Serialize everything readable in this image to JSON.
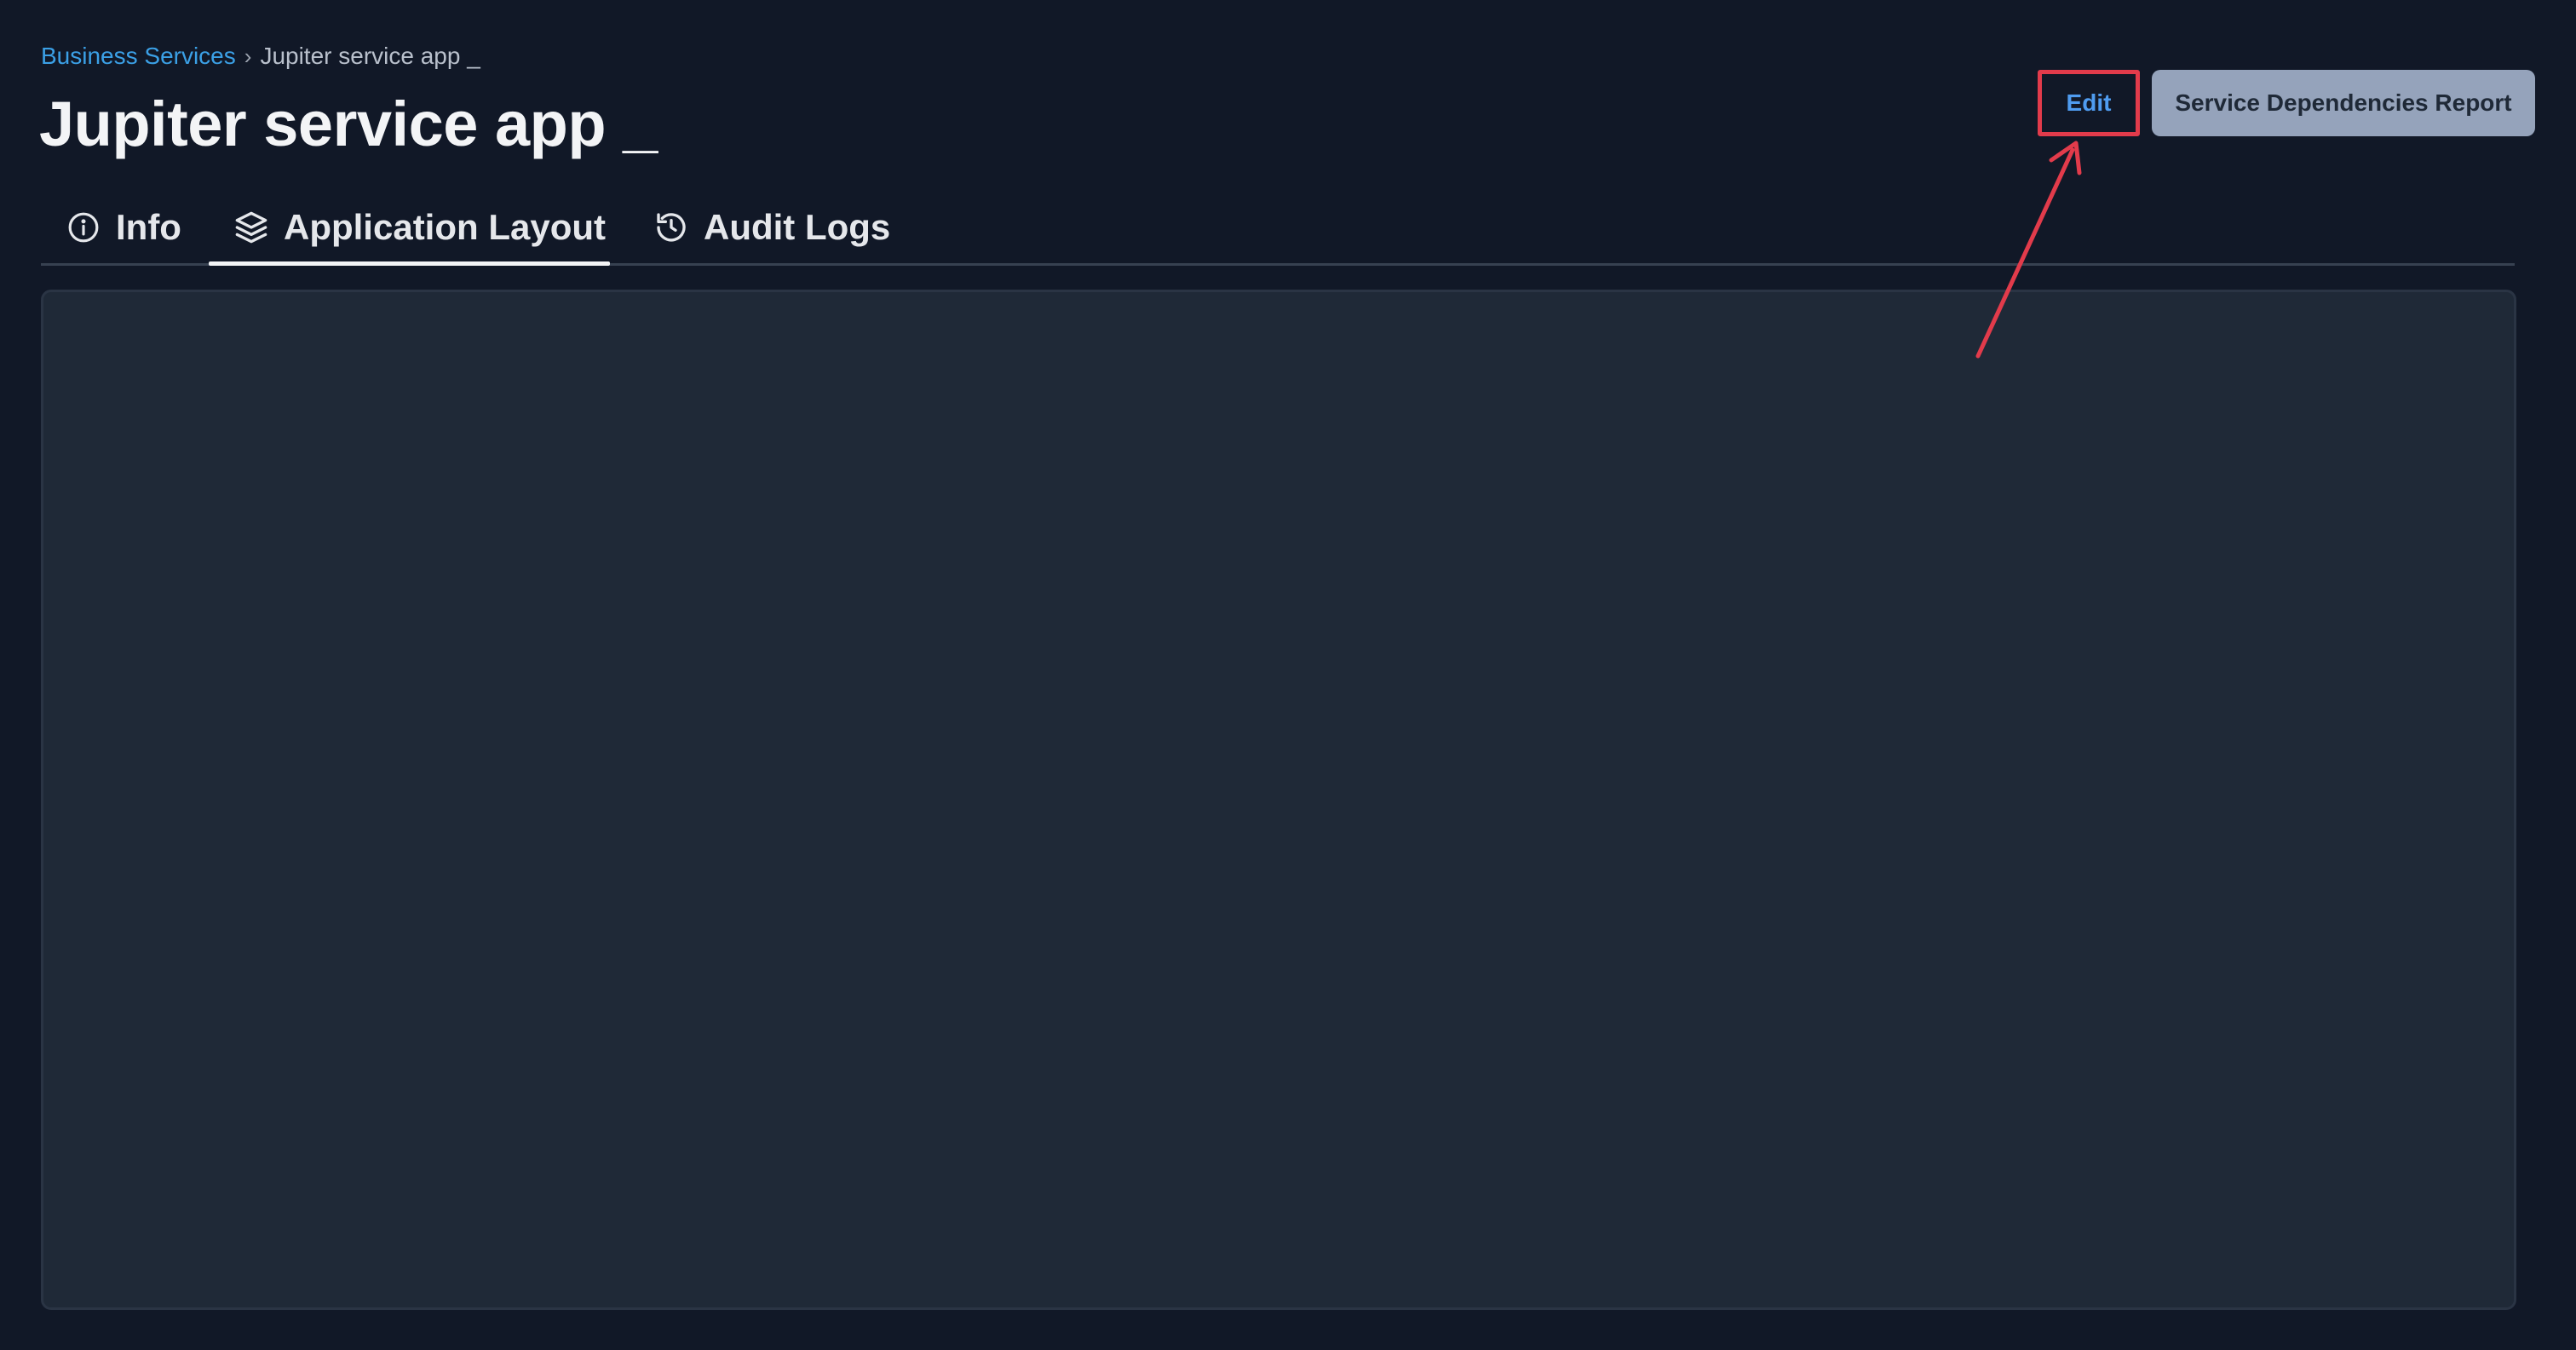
{
  "breadcrumb": {
    "parent_label": "Business Services",
    "separator": "›",
    "current_label": "Jupiter service app _"
  },
  "header": {
    "title": "Jupiter service app _",
    "edit_label": "Edit",
    "report_label": "Service Dependencies Report"
  },
  "tabs": [
    {
      "label": "Info",
      "icon": "info-circle-icon"
    },
    {
      "label": "Application Layout",
      "icon": "layers-icon",
      "active": true
    },
    {
      "label": "Audit Logs",
      "icon": "history-icon"
    }
  ],
  "colors": {
    "page_background": "#111827",
    "panel_background": "#1f2937",
    "breadcrumb_link": "#3ba0e6",
    "edit_text": "#4f9cf0",
    "report_button_background": "#95a3bb",
    "annotation": "#e23b4b"
  }
}
